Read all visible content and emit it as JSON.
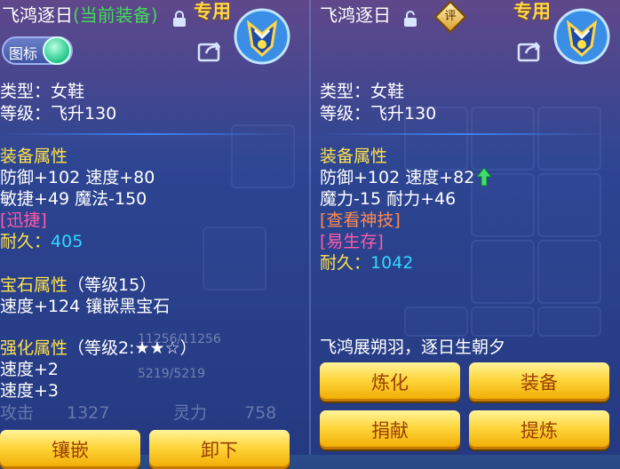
{
  "left": {
    "title": "飞鸿逐日",
    "title_status": "(当前装备)",
    "tag": "专用",
    "toggle_label": "图标",
    "type": "类型：女鞋",
    "level": "等级：飞升130",
    "attr_header": "装备属性",
    "attr_line1": "防御+102 速度+80",
    "attr_line2": "敏捷+49 魔法-150",
    "special": "[迅捷]",
    "durability_label": "耐久：",
    "durability_value": "405",
    "gem_header": "宝石属性",
    "gem_level": "（等级15）",
    "gem_line": "速度+124 镶嵌黑宝石",
    "enhance_header": "强化属性",
    "enhance_level": "（等级2:★★☆）",
    "enhance_line1": "速度+2",
    "enhance_line2": "速度+3",
    "btn_inlay": "镶嵌",
    "btn_unequip": "卸下",
    "bg_attack_label": "攻击",
    "bg_attack_value": "1327",
    "bg_spirit_label": "灵力",
    "bg_spirit_value": "758",
    "bg_hp": "11256/11256",
    "bg_mp": "5219/5219"
  },
  "right": {
    "title": "飞鸿逐日",
    "rate_badge": "评",
    "tag": "专用",
    "type": "类型：女鞋",
    "level": "等级：飞升130",
    "attr_header": "装备属性",
    "attr_line1": "防御+102 速度+82",
    "attr_line2": "魔力-15 耐力+46",
    "skill": "[查看神技]",
    "special": "[易生存]",
    "durability_label": "耐久：",
    "durability_value": "1042",
    "flavor": "飞鸿展朔羽，逐日生朝夕",
    "btn_refine": "炼化",
    "btn_equip": "装备",
    "btn_donate": "捐献",
    "btn_extract": "提炼"
  },
  "colors": {
    "yellow": "#ffe14a",
    "green": "#43d95a",
    "cyan": "#2fd8ff",
    "pink": "#ff5aa8",
    "orange": "#ff8a50",
    "button_gold": "#ffd53a"
  }
}
